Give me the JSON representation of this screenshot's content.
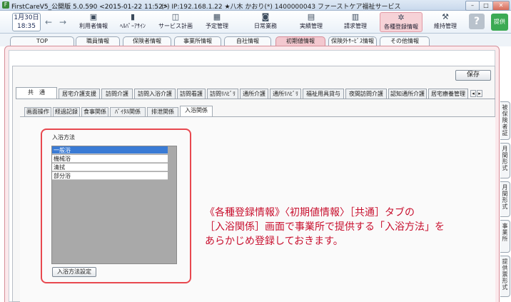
{
  "window": {
    "title": "FirstCareV5_公開版 5.0.590 <2015-01-22 11:52>",
    "host": "(*) IP:192.168.1.22 ★八木 かおり(*) 1400000043 ファーストケア福祉サービス",
    "min": "–",
    "max": "□",
    "close": "✕"
  },
  "date": {
    "line1": "1月30日",
    "line2": "18:35"
  },
  "toolbar": {
    "back": "←",
    "forward": "→",
    "items": [
      {
        "label": "利用者情報",
        "icon": "▣"
      },
      {
        "label": "ﾍﾙﾊﾟｰｱｻｲﾝ",
        "icon": "▮"
      },
      {
        "label": "サービス計画",
        "icon": "◫"
      },
      {
        "label": "予定管理",
        "icon": "▦"
      },
      {
        "label": "日常業務",
        "icon": "◙"
      },
      {
        "label": "実績管理",
        "icon": "▤"
      },
      {
        "label": "請求管理",
        "icon": "▥"
      },
      {
        "label": "各種登録情報",
        "icon": "✲"
      },
      {
        "label": "維持管理",
        "icon": "⚒"
      }
    ],
    "help": "?",
    "provide": "提供"
  },
  "top_tabs": [
    "TOP",
    "職員情報",
    "保険者情報",
    "事業所情報",
    "自社情報",
    "初期値情報",
    "保険外ｻｰﾋﾞｽ情報",
    "その他情報"
  ],
  "save_label": "保存",
  "category_tabs": [
    "共　通",
    "居宅介護支援",
    "訪問介護",
    "訪問入浴介護",
    "訪問看護",
    "訪問ﾘﾊﾋﾞﾘ",
    "通所介護",
    "通所ﾘﾊﾋﾞﾘ",
    "福祉用具貸与",
    "夜間訪問介護",
    "認知通所介護",
    "居宅療養管理"
  ],
  "scroll": {
    "left": "◂",
    "right": "▸"
  },
  "sub_tabs": [
    "画面操作",
    "経過記録",
    "食事関係",
    "ﾊﾞｲﾀﾙ関係",
    "排泄関係",
    "入浴関係"
  ],
  "bath": {
    "label": "入浴方法",
    "options": [
      "一般浴",
      "機械浴",
      "清拭",
      "部分浴"
    ],
    "selected": "一般浴",
    "button": "入浴方法設定"
  },
  "annotation": [
    "《各種登録情報》〈初期値情報〉［共通］タブの",
    "［入浴関係］画面で事業所で提供する「入浴方法」を",
    "あらかじめ登録しておきます。"
  ],
  "side_tabs": [
    "被保険者証",
    "月間形式",
    "月間形式",
    "事業所",
    "提供票形式"
  ],
  "colors": {
    "accent_pink": "#f3c8cf",
    "highlight_red": "#e8484f",
    "annotation_red": "#c8102e",
    "selection_blue": "#3a7bd5"
  }
}
